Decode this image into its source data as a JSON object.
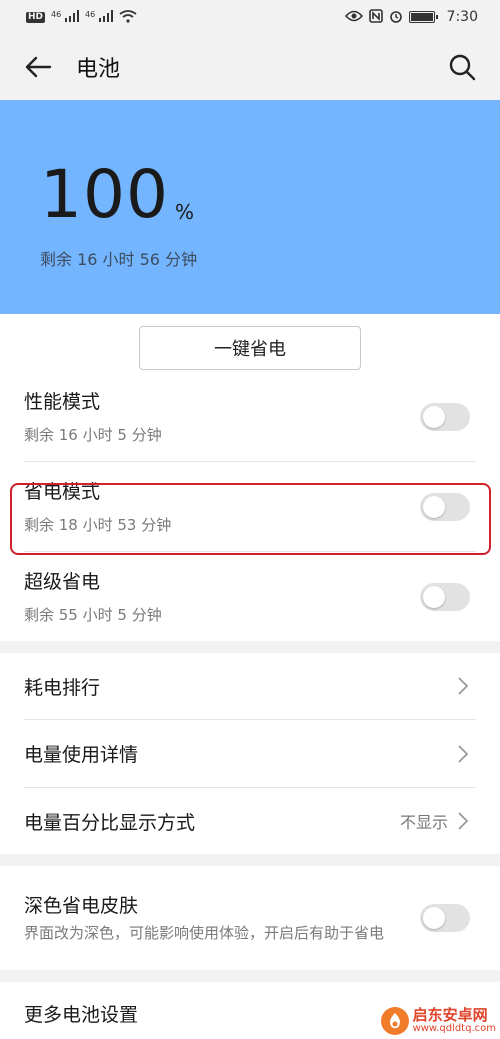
{
  "status_bar": {
    "left": [
      "HD",
      "46",
      "46"
    ],
    "time": "7:30",
    "icons": [
      "hd-icon",
      "signal-icon",
      "signal-icon",
      "wifi-icon",
      "eye-icon",
      "nfc-icon",
      "alarm-icon",
      "battery-icon"
    ]
  },
  "header": {
    "title": "电池"
  },
  "hero": {
    "percent": "100",
    "unit": "%",
    "remaining": "剩余 16 小时 56 分钟",
    "background": "#73b5ff"
  },
  "one_key": {
    "label": "一键省电"
  },
  "modes": [
    {
      "title": "性能模式",
      "subtitle": "剩余 16 小时 5 分钟",
      "enabled": false
    },
    {
      "title": "省电模式",
      "subtitle": "剩余 18 小时 53 分钟",
      "enabled": false
    },
    {
      "title": "超级省电",
      "subtitle": "剩余 55 小时 5 分钟",
      "enabled": false
    }
  ],
  "nav_items": [
    {
      "title": "耗电排行",
      "value": ""
    },
    {
      "title": "电量使用详情",
      "value": ""
    },
    {
      "title": "电量百分比显示方式",
      "value": "不显示"
    }
  ],
  "dark_skin": {
    "title": "深色省电皮肤",
    "subtitle": "界面改为深色，可能影响使用体验，开启后有助于省电",
    "enabled": false
  },
  "more": {
    "title": "更多电池设置"
  },
  "watermark": {
    "name": "启东安卓网",
    "url": "www.qdldtq.com"
  },
  "colors": {
    "highlight": "#d0202a",
    "toggle_off": "#e2e2e2"
  }
}
